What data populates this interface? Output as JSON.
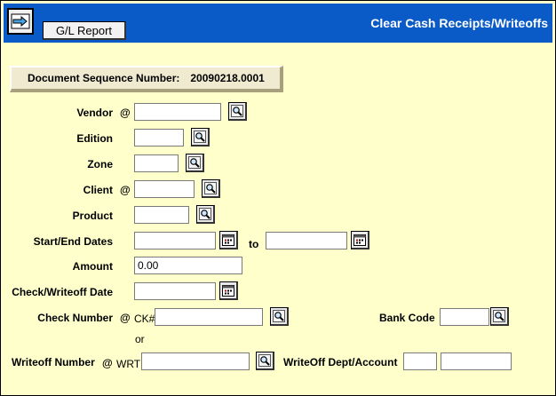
{
  "header": {
    "title": "Clear Cash Receipts/Writeoffs",
    "report_button": "G/L Report",
    "nav_icon": "arrow-right-icon",
    "brand_color": "#0a5ac8"
  },
  "doc_sequence": {
    "label": "Document Sequence Number:",
    "value": "20090218.0001"
  },
  "form": {
    "vendor": {
      "label": "Vendor",
      "at": "@",
      "value": ""
    },
    "edition": {
      "label": "Edition",
      "value": ""
    },
    "zone": {
      "label": "Zone",
      "value": ""
    },
    "client": {
      "label": "Client",
      "at": "@",
      "value": ""
    },
    "product": {
      "label": "Product",
      "value": ""
    },
    "dates": {
      "label": "Start/End Dates",
      "to": "to",
      "start": "",
      "end": ""
    },
    "amount": {
      "label": "Amount",
      "value": "0.00"
    },
    "check_date": {
      "label": "Check/Writeoff Date",
      "value": ""
    },
    "check_number": {
      "label": "Check Number",
      "at": "@",
      "prefix": "CK#",
      "value": ""
    },
    "bank_code": {
      "label": "Bank Code",
      "value": ""
    },
    "or_text": "or",
    "writeoff_number": {
      "label": "Writeoff Number",
      "at": "@",
      "prefix": "WRT",
      "value": ""
    },
    "writeoff_dept": {
      "label": "WriteOff Dept/Account",
      "dept": "",
      "account": ""
    }
  },
  "icons": {
    "lookup": "magnifier-icon",
    "calendar": "calendar-icon"
  }
}
